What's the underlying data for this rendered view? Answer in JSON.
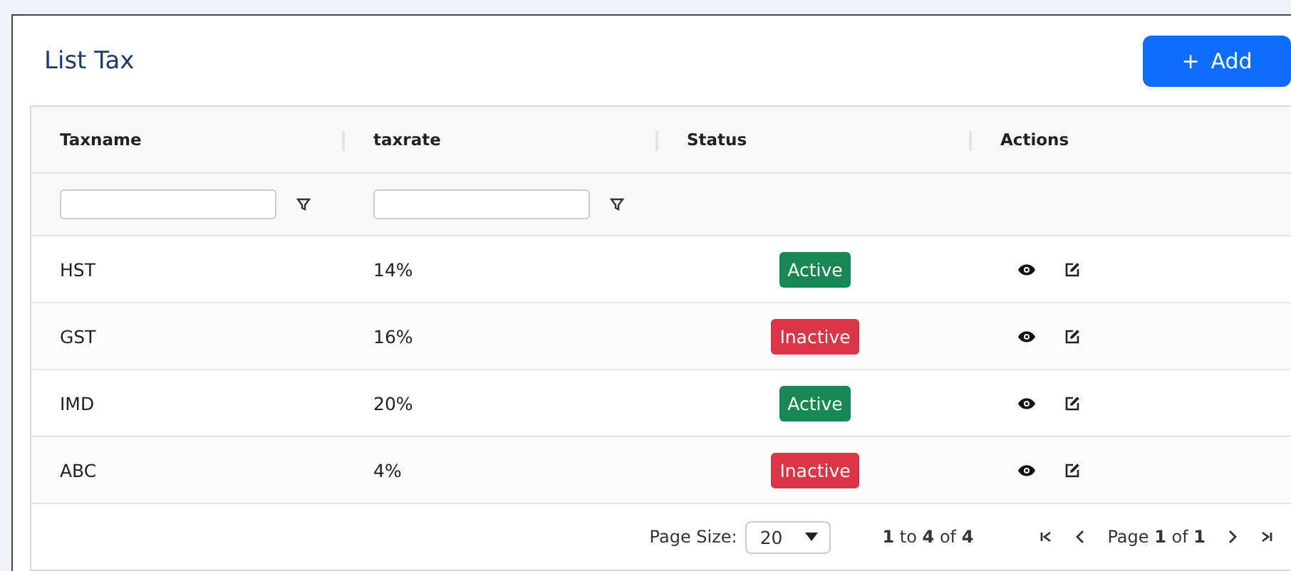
{
  "title": "List Tax",
  "add_button": {
    "icon": "+",
    "label": "Add"
  },
  "table": {
    "columns": [
      "Taxname",
      "taxrate",
      "Status",
      "Actions"
    ],
    "filters": [
      {
        "kind": "text"
      },
      {
        "kind": "text"
      }
    ],
    "rows": [
      {
        "taxname": "HST",
        "taxrate": "14%",
        "status": {
          "label": "Active",
          "kind": "active"
        }
      },
      {
        "taxname": "GST",
        "taxrate": "16%",
        "status": {
          "label": "Inactive",
          "kind": "inactive"
        }
      },
      {
        "taxname": "IMD",
        "taxrate": "20%",
        "status": {
          "label": "Active",
          "kind": "active"
        }
      },
      {
        "taxname": "ABC",
        "taxrate": "4%",
        "status": {
          "label": "Inactive",
          "kind": "inactive"
        }
      }
    ]
  },
  "pagination": {
    "page_size_label": "Page Size:",
    "page_size": "20",
    "range": "**1** to **4** of **4**",
    "page": "Page **1** of **1**"
  }
}
